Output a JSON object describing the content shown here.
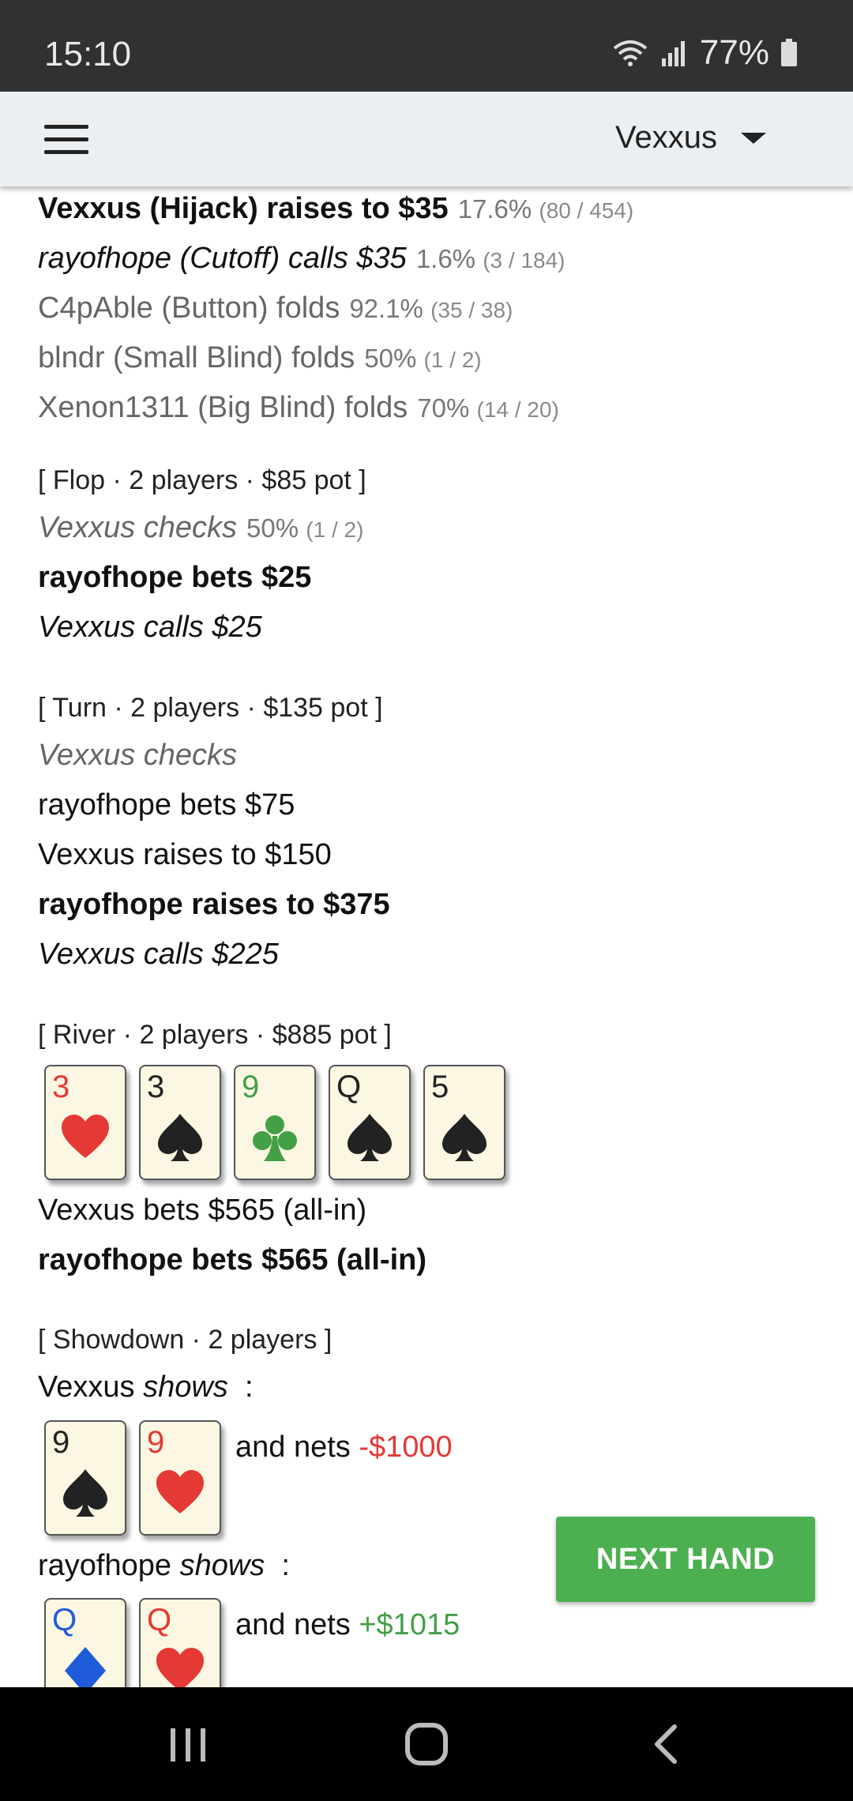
{
  "status_bar": {
    "time": "15:10",
    "battery": "77%"
  },
  "app_bar": {
    "user": "Vexxus"
  },
  "preflop": [
    {
      "text": "Vexxus (Hijack) raises to $35",
      "pct": "17.6%",
      "ratio": "(80 / 454)"
    },
    {
      "text": "rayofhope (Cutoff) calls $35",
      "pct": "1.6%",
      "ratio": "(3 / 184)"
    },
    {
      "text": "C4pAble (Button) folds",
      "pct": "92.1%",
      "ratio": "(35 / 38)"
    },
    {
      "text": "blndr (Small Blind) folds",
      "pct": "50%",
      "ratio": "(1 / 2)"
    },
    {
      "text": "Xenon1311 (Big Blind) folds",
      "pct": "70%",
      "ratio": "(14 / 20)"
    }
  ],
  "flop": {
    "header": "[ Flop · 2 players · $85 pot ]",
    "actions": [
      {
        "text": "Vexxus checks",
        "pct": "50%",
        "ratio": "(1 / 2)"
      },
      {
        "text": "rayofhope bets $25"
      },
      {
        "text": "Vexxus calls $25"
      }
    ]
  },
  "turn": {
    "header": "[ Turn · 2 players · $135 pot ]",
    "actions": [
      {
        "text": "Vexxus checks"
      },
      {
        "text": "rayofhope bets $75"
      },
      {
        "text": "Vexxus raises to $150"
      },
      {
        "text": "rayofhope raises to $375"
      },
      {
        "text": "Vexxus calls $225"
      }
    ]
  },
  "river": {
    "header": "[ River · 2 players · $885 pot ]",
    "board": [
      {
        "rank": "3",
        "suit": "heart",
        "color": "#e53935"
      },
      {
        "rank": "3",
        "suit": "spade",
        "color": "#222222"
      },
      {
        "rank": "9",
        "suit": "club",
        "color": "#43a047"
      },
      {
        "rank": "Q",
        "suit": "spade",
        "color": "#222222"
      },
      {
        "rank": "5",
        "suit": "spade",
        "color": "#222222"
      }
    ],
    "actions": [
      {
        "text": "Vexxus bets $565 (all-in)"
      },
      {
        "text": "rayofhope bets $565 (all-in)"
      }
    ]
  },
  "showdown": {
    "header": "[ Showdown · 2 players ]",
    "players": [
      {
        "name": "Vexxus",
        "shows": "shows",
        "colon": ":",
        "cards": [
          {
            "rank": "9",
            "suit": "spade",
            "color": "#222222"
          },
          {
            "rank": "9",
            "suit": "heart",
            "color": "#e53935"
          }
        ],
        "nets_label": "and nets",
        "nets_value": "-$1000"
      },
      {
        "name": "rayofhope",
        "shows": "shows",
        "colon": ":",
        "cards": [
          {
            "rank": "Q",
            "suit": "diamond",
            "color": "#1e5bd8"
          },
          {
            "rank": "Q",
            "suit": "heart",
            "color": "#e53935"
          }
        ],
        "nets_label": "and nets",
        "nets_value": "+$1015"
      }
    ]
  },
  "next_hand_label": "NEXT HAND",
  "colors": {
    "accent": "#4caf50",
    "loss": "#e53935",
    "win": "#43a047"
  }
}
